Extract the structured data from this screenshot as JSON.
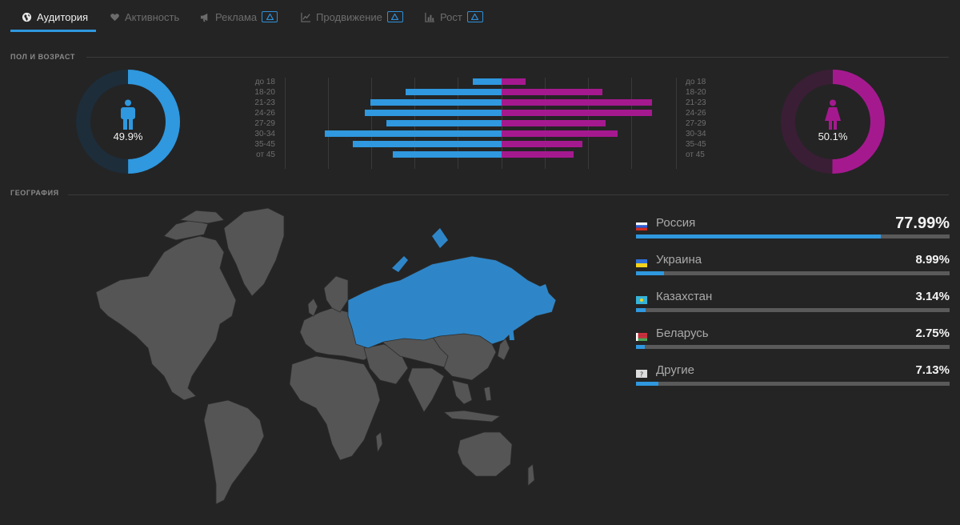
{
  "tabs": [
    {
      "label": "Аудитория",
      "icon": "globe-icon",
      "active": true,
      "locked": false
    },
    {
      "label": "Активность",
      "icon": "heart-icon",
      "active": false,
      "locked": false
    },
    {
      "label": "Реклама",
      "icon": "megaphone-icon",
      "active": false,
      "locked": true
    },
    {
      "label": "Продвижение",
      "icon": "line-chart-icon",
      "active": false,
      "locked": true
    },
    {
      "label": "Рост",
      "icon": "bar-chart-icon",
      "active": false,
      "locked": true
    }
  ],
  "sections": {
    "gender_age": "ПОЛ И ВОЗРАСТ",
    "geography": "ГЕОГРАФИЯ"
  },
  "gender": {
    "male_pct": "49.9%",
    "female_pct": "50.1%",
    "male_value": 0.499,
    "female_value": 0.501,
    "male_color": "#2f98df",
    "female_color": "#a5198f"
  },
  "age_labels": [
    "до 18",
    "18-20",
    "21-23",
    "24-26",
    "27-29",
    "30-34",
    "35-45",
    "от 45"
  ],
  "chart_data": {
    "type": "bar",
    "categories": [
      "до 18",
      "18-20",
      "21-23",
      "24-26",
      "27-29",
      "30-34",
      "35-45",
      "от 45"
    ],
    "series": [
      {
        "values": [
          2.3,
          7.6,
          10.4,
          10.8,
          9.1,
          14.0,
          11.8,
          8.6
        ],
        "color": "#2f98df"
      },
      {
        "values": [
          1.9,
          8.0,
          11.9,
          11.9,
          8.2,
          9.2,
          6.4,
          5.7
        ],
        "color": "#a5198f"
      }
    ],
    "orientation": "horizontal-mirrored"
  },
  "countries": [
    {
      "name": "Россия",
      "pct": "77.99%",
      "value": 0.7799,
      "flag": "russia-flag-icon"
    },
    {
      "name": "Украина",
      "pct": "8.99%",
      "value": 0.0899,
      "flag": "ukraine-flag-icon"
    },
    {
      "name": "Казахстан",
      "pct": "3.14%",
      "value": 0.0314,
      "flag": "kazakhstan-flag-icon"
    },
    {
      "name": "Беларусь",
      "pct": "2.75%",
      "value": 0.0275,
      "flag": "belarus-flag-icon"
    },
    {
      "name": "Другие",
      "pct": "7.13%",
      "value": 0.0713,
      "flag": "unknown-flag-icon"
    }
  ],
  "map": {
    "highlight": "Россия",
    "highlight_color": "#2e86c8",
    "base_color": "#555555"
  }
}
